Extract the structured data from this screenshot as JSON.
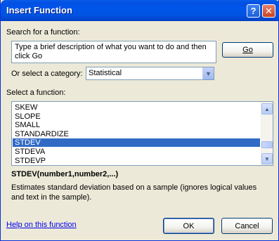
{
  "window": {
    "title": "Insert Function",
    "help_glyph": "?",
    "close_glyph": "✕"
  },
  "search": {
    "label": "Search for a function:",
    "text": "Type a brief description of what you want to do and then click Go",
    "go_label": "Go"
  },
  "category": {
    "label": "Or select a category:",
    "value": "Statistical"
  },
  "functions": {
    "label": "Select a function:",
    "items": [
      "SKEW",
      "SLOPE",
      "SMALL",
      "STANDARDIZE",
      "STDEV",
      "STDEVA",
      "STDEVP"
    ],
    "selected": "STDEV"
  },
  "selected_info": {
    "signature": "STDEV(number1,number2,...)",
    "description": "Estimates standard deviation based on a sample (ignores logical values and text in the sample)."
  },
  "footer": {
    "help_link": "Help on this function",
    "ok_label": "OK",
    "cancel_label": "Cancel"
  }
}
